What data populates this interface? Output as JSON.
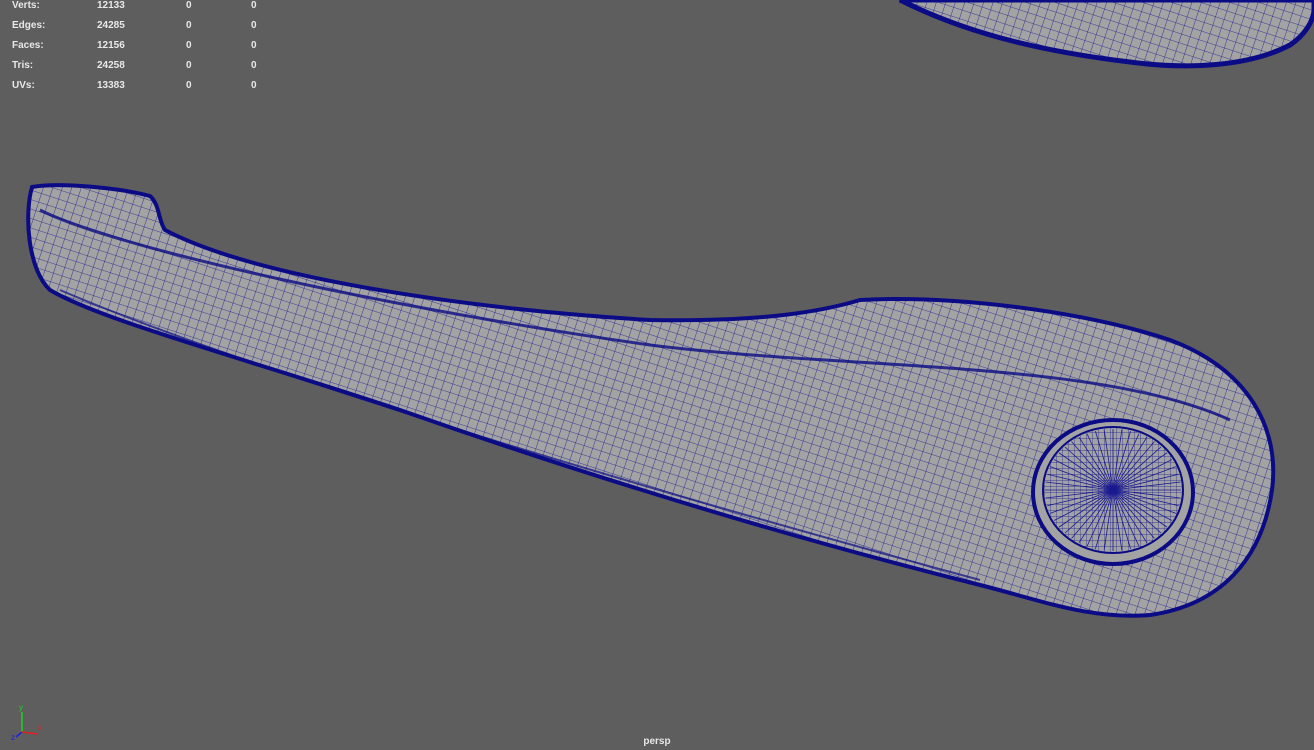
{
  "hud": {
    "rows": [
      {
        "label": "Verts:",
        "total": "12133",
        "selected": "0",
        "uv": "0"
      },
      {
        "label": "Edges:",
        "total": "24285",
        "selected": "0",
        "uv": "0"
      },
      {
        "label": "Faces:",
        "total": "12156",
        "selected": "0",
        "uv": "0"
      },
      {
        "label": "Tris:",
        "total": "24258",
        "selected": "0",
        "uv": "0"
      },
      {
        "label": "UVs:",
        "total": "13383",
        "selected": "0",
        "uv": "0"
      }
    ]
  },
  "camera_label": "persp",
  "axis": {
    "x": "x",
    "y": "y",
    "z": "z",
    "x_color": "#e02020",
    "y_color": "#20d020",
    "z_color": "#2020e0"
  },
  "colors": {
    "background": "#5e5e5e",
    "mesh_fill": "#a3a3a3",
    "wire": "#0b0b85"
  }
}
